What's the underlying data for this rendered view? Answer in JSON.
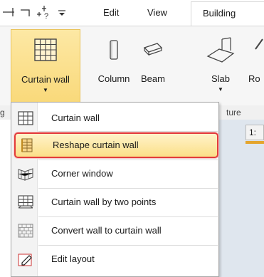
{
  "tabs": {
    "edit": "Edit",
    "view": "View",
    "building": "Building"
  },
  "ribbon": {
    "curtain_wall": "Curtain wall",
    "column": "Column",
    "beam": "Beam",
    "slab": "Slab",
    "r_partial": "Ro",
    "group_label": "ture",
    "group_left": "g"
  },
  "right_tab_text": "1:",
  "menu": {
    "items": [
      {
        "label": "Curtain wall",
        "icon": "curtain-wall-icon"
      },
      {
        "label": "Reshape curtain wall",
        "icon": "reshape-curtain-wall-icon",
        "selected": true
      },
      {
        "label": "Corner window",
        "icon": "corner-window-icon"
      },
      {
        "label": "Curtain wall by two points",
        "icon": "curtain-wall-two-points-icon"
      },
      {
        "label": "Convert wall to curtain wall",
        "icon": "convert-wall-icon"
      },
      {
        "label": "Edit layout",
        "icon": "edit-layout-icon"
      }
    ]
  },
  "colors": {
    "active_fill": "#fbdf88",
    "highlight_border": "#e23b3b",
    "accent_orange": "#e4a52e"
  }
}
